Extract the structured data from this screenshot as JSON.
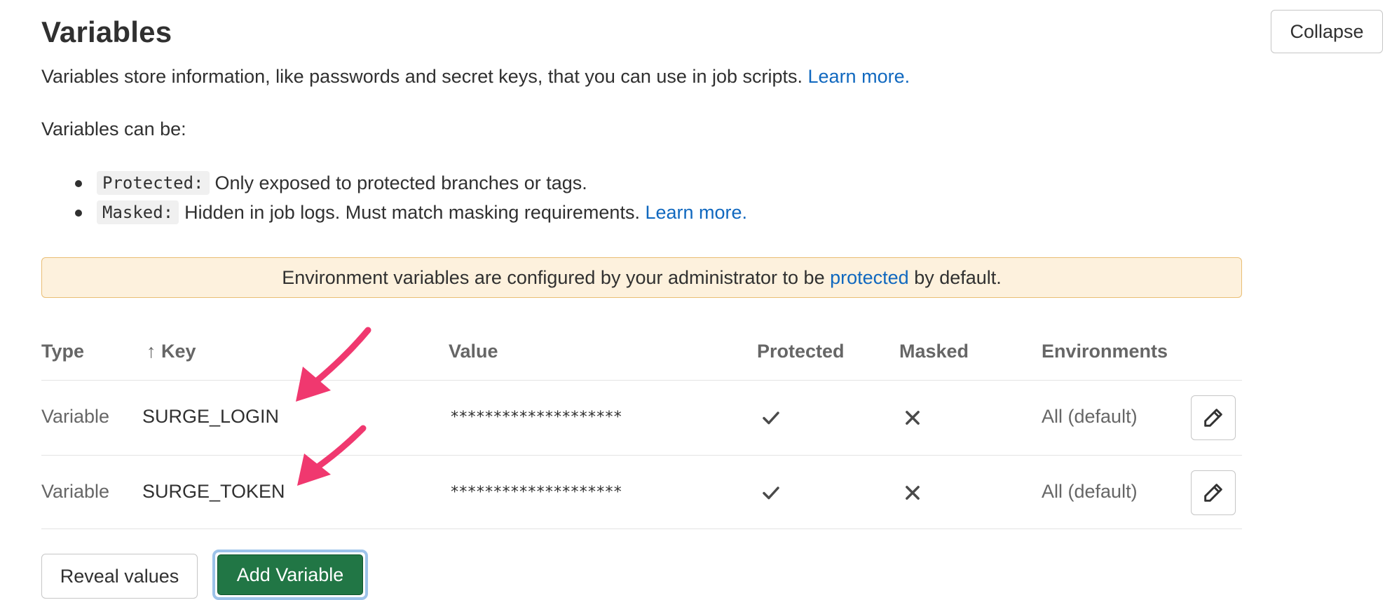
{
  "header": {
    "title": "Variables",
    "collapse_label": "Collapse"
  },
  "intro": {
    "text": "Variables store information, like passwords and secret keys, that you can use in job scripts. ",
    "link": "Learn more."
  },
  "can_be": "Variables can be:",
  "bullets": [
    {
      "code": "Protected:",
      "text": " Only exposed to protected branches or tags.",
      "link": ""
    },
    {
      "code": "Masked:",
      "text": " Hidden in job logs. Must match masking requirements. ",
      "link": "Learn more."
    }
  ],
  "alert": {
    "before": "Environment variables are configured by your administrator to be ",
    "link": "protected",
    "after": " by default."
  },
  "table": {
    "headers": {
      "type": "Type",
      "key_arrow": "↑",
      "key": "Key",
      "value": "Value",
      "protected": "Protected",
      "masked": "Masked",
      "environments": "Environments"
    },
    "rows": [
      {
        "type": "Variable",
        "key": "SURGE_LOGIN",
        "value": "********************",
        "protected_icon": "check-icon",
        "masked_icon": "close-icon",
        "environments": "All (default)",
        "action_icon": "pencil-icon"
      },
      {
        "type": "Variable",
        "key": "SURGE_TOKEN",
        "value": "********************",
        "protected_icon": "check-icon",
        "masked_icon": "close-icon",
        "environments": "All (default)",
        "action_icon": "pencil-icon"
      }
    ]
  },
  "footer": {
    "reveal_label": "Reveal values",
    "add_label": "Add Variable"
  },
  "colors": {
    "link": "#1068bf",
    "alert_bg": "#fdf1dd",
    "alert_border": "#e9be74",
    "primary_button": "#217645",
    "annotation_arrow": "#f0386f"
  }
}
